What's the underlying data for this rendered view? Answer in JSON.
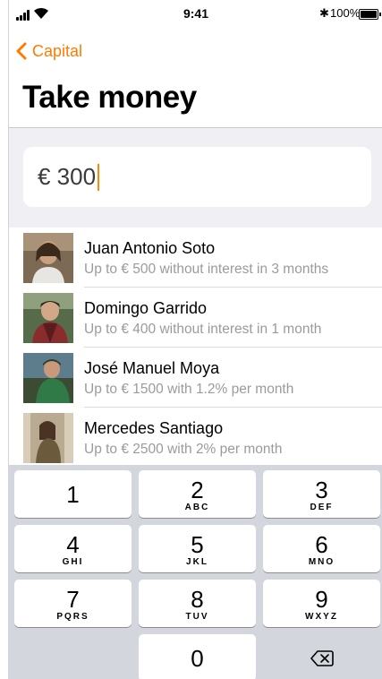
{
  "status_bar": {
    "time": "9:41",
    "battery": "100%"
  },
  "nav": {
    "back_label": "Capital",
    "title": "Take money"
  },
  "amount": {
    "value": "€ 300"
  },
  "lenders": [
    {
      "name": "Juan Antonio Soto",
      "terms": "Up to € 500 without interest in 3 months"
    },
    {
      "name": "Domingo Garrido",
      "terms": "Up to € 400 without interest in 1 month"
    },
    {
      "name": "José Manuel Moya",
      "terms": "Up to € 1500 with 1.2% per month"
    },
    {
      "name": "Mercedes Santiago",
      "terms": "Up to € 2500 with 2% per month"
    }
  ],
  "keypad": [
    {
      "digit": "1",
      "letters": ""
    },
    {
      "digit": "2",
      "letters": "ABC"
    },
    {
      "digit": "3",
      "letters": "DEF"
    },
    {
      "digit": "4",
      "letters": "GHI"
    },
    {
      "digit": "5",
      "letters": "JKL"
    },
    {
      "digit": "6",
      "letters": "MNO"
    },
    {
      "digit": "7",
      "letters": "PQRS"
    },
    {
      "digit": "8",
      "letters": "TUV"
    },
    {
      "digit": "9",
      "letters": "WXYZ"
    },
    {
      "digit": "0",
      "letters": ""
    }
  ],
  "colors": {
    "accent": "#ff7b00",
    "caret": "#ff8a00",
    "keypad_bg": "#d3d6dc"
  }
}
